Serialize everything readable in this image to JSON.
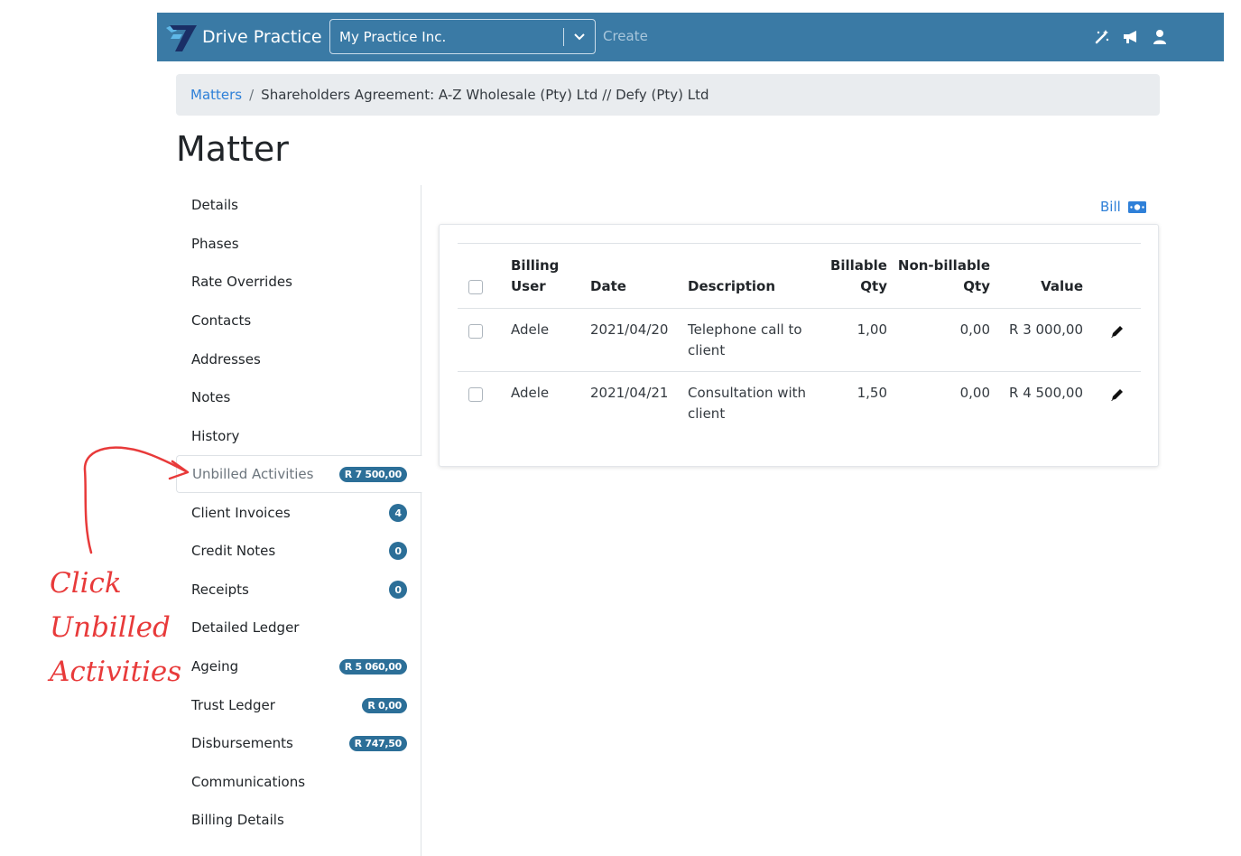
{
  "navbar": {
    "brand": "Drive Practice",
    "practice_select": "My Practice Inc.",
    "create_label": "Create",
    "icons": [
      "magic-wand-icon",
      "megaphone-icon",
      "user-icon"
    ]
  },
  "breadcrumb": {
    "root": "Matters",
    "separator": "/",
    "current": "Shareholders Agreement: A-Z Wholesale (Pty) Ltd // Defy (Pty) Ltd"
  },
  "page": {
    "title": "Matter"
  },
  "sidebar": {
    "items": [
      {
        "label": "Details",
        "badge": ""
      },
      {
        "label": "Phases",
        "badge": ""
      },
      {
        "label": "Rate Overrides",
        "badge": ""
      },
      {
        "label": "Contacts",
        "badge": ""
      },
      {
        "label": "Addresses",
        "badge": ""
      },
      {
        "label": "Notes",
        "badge": ""
      },
      {
        "label": "History",
        "badge": ""
      },
      {
        "label": "Unbilled Activities",
        "badge": "R 7 500,00",
        "active": true
      },
      {
        "label": "Client Invoices",
        "badge": "4"
      },
      {
        "label": "Credit Notes",
        "badge": "0"
      },
      {
        "label": "Receipts",
        "badge": "0"
      },
      {
        "label": "Detailed Ledger",
        "badge": ""
      },
      {
        "label": "Ageing",
        "badge": "R 5 060,00"
      },
      {
        "label": "Trust Ledger",
        "badge": "R 0,00"
      },
      {
        "label": "Disbursements",
        "badge": "R 747,50"
      },
      {
        "label": "Communications",
        "badge": ""
      },
      {
        "label": "Billing Details",
        "badge": ""
      }
    ]
  },
  "bill_action": {
    "label": "Bill",
    "icon": "money-bill-icon"
  },
  "table": {
    "headers": {
      "billing_user_1": "Billing",
      "billing_user_2": "User",
      "date": "Date",
      "description": "Description",
      "billable_1": "Billable",
      "billable_2": "Qty",
      "nonbillable_1": "Non-billable",
      "nonbillable_2": "Qty",
      "value": "Value"
    },
    "rows": [
      {
        "user": "Adele",
        "date": "2021/04/20",
        "desc_1": "Telephone call to",
        "desc_2": "client",
        "billable": "1,00",
        "nonbillable": "0,00",
        "value": "R 3 000,00"
      },
      {
        "user": "Adele",
        "date": "2021/04/21",
        "desc_1": "Consultation with",
        "desc_2": "client",
        "billable": "1,50",
        "nonbillable": "0,00",
        "value": "R 4 500,00"
      }
    ]
  },
  "annotation": {
    "line_1": "Click",
    "line_2": "Unbilled",
    "line_3": "Activities",
    "color": "#e83a3a"
  },
  "colors": {
    "navbar": "#3a7aa5",
    "badge": "#2c6f98",
    "link": "#2f80d8",
    "breadcrumb_bg": "#e9ecef"
  }
}
